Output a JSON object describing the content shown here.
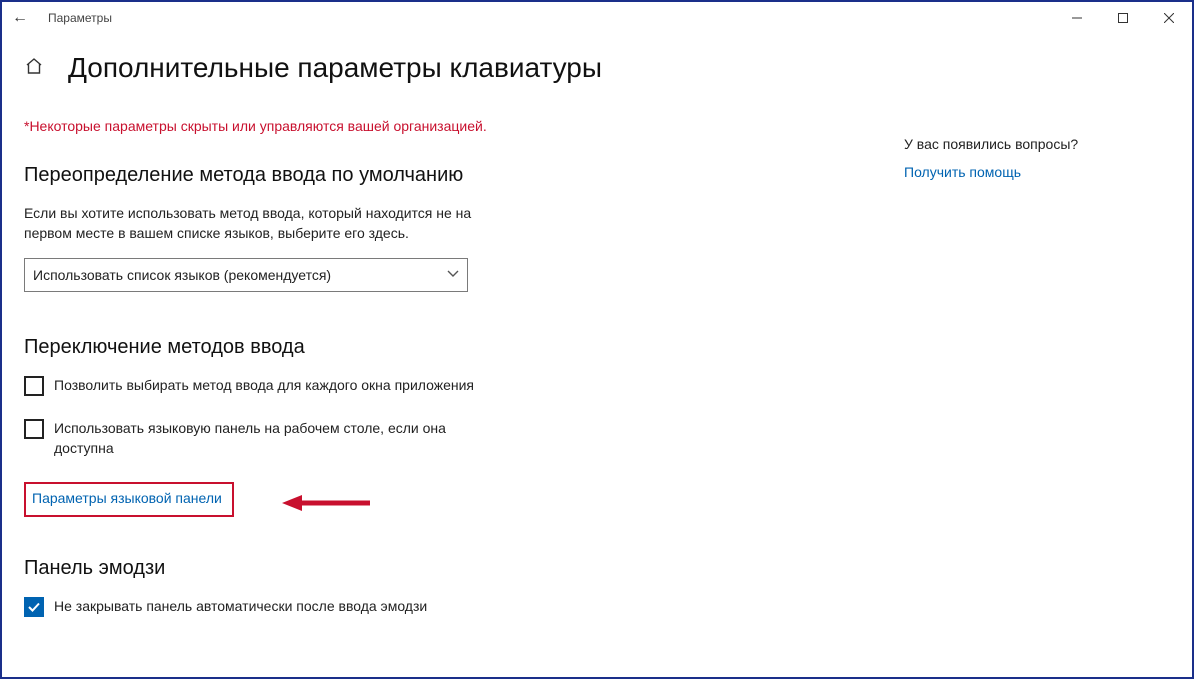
{
  "window": {
    "title": "Параметры"
  },
  "page": {
    "title": "Дополнительные параметры клавиатуры",
    "warning": "*Некоторые параметры скрыты или управляются вашей организацией."
  },
  "section1": {
    "heading": "Переопределение метода ввода по умолчанию",
    "desc": "Если вы хотите использовать метод ввода, который находится не на первом месте в вашем списке языков, выберите его здесь.",
    "dropdown_value": "Использовать список языков (рекомендуется)"
  },
  "section2": {
    "heading": "Переключение методов ввода",
    "cb1": "Позволить выбирать метод ввода для каждого окна приложения",
    "cb2": "Использовать языковую панель на рабочем столе, если она доступна",
    "link": "Параметры языковой панели"
  },
  "section3": {
    "heading": "Панель эмодзи",
    "cb1": "Не закрывать панель автоматически после ввода эмодзи"
  },
  "aside": {
    "question": "У вас появились вопросы?",
    "help": "Получить помощь"
  }
}
